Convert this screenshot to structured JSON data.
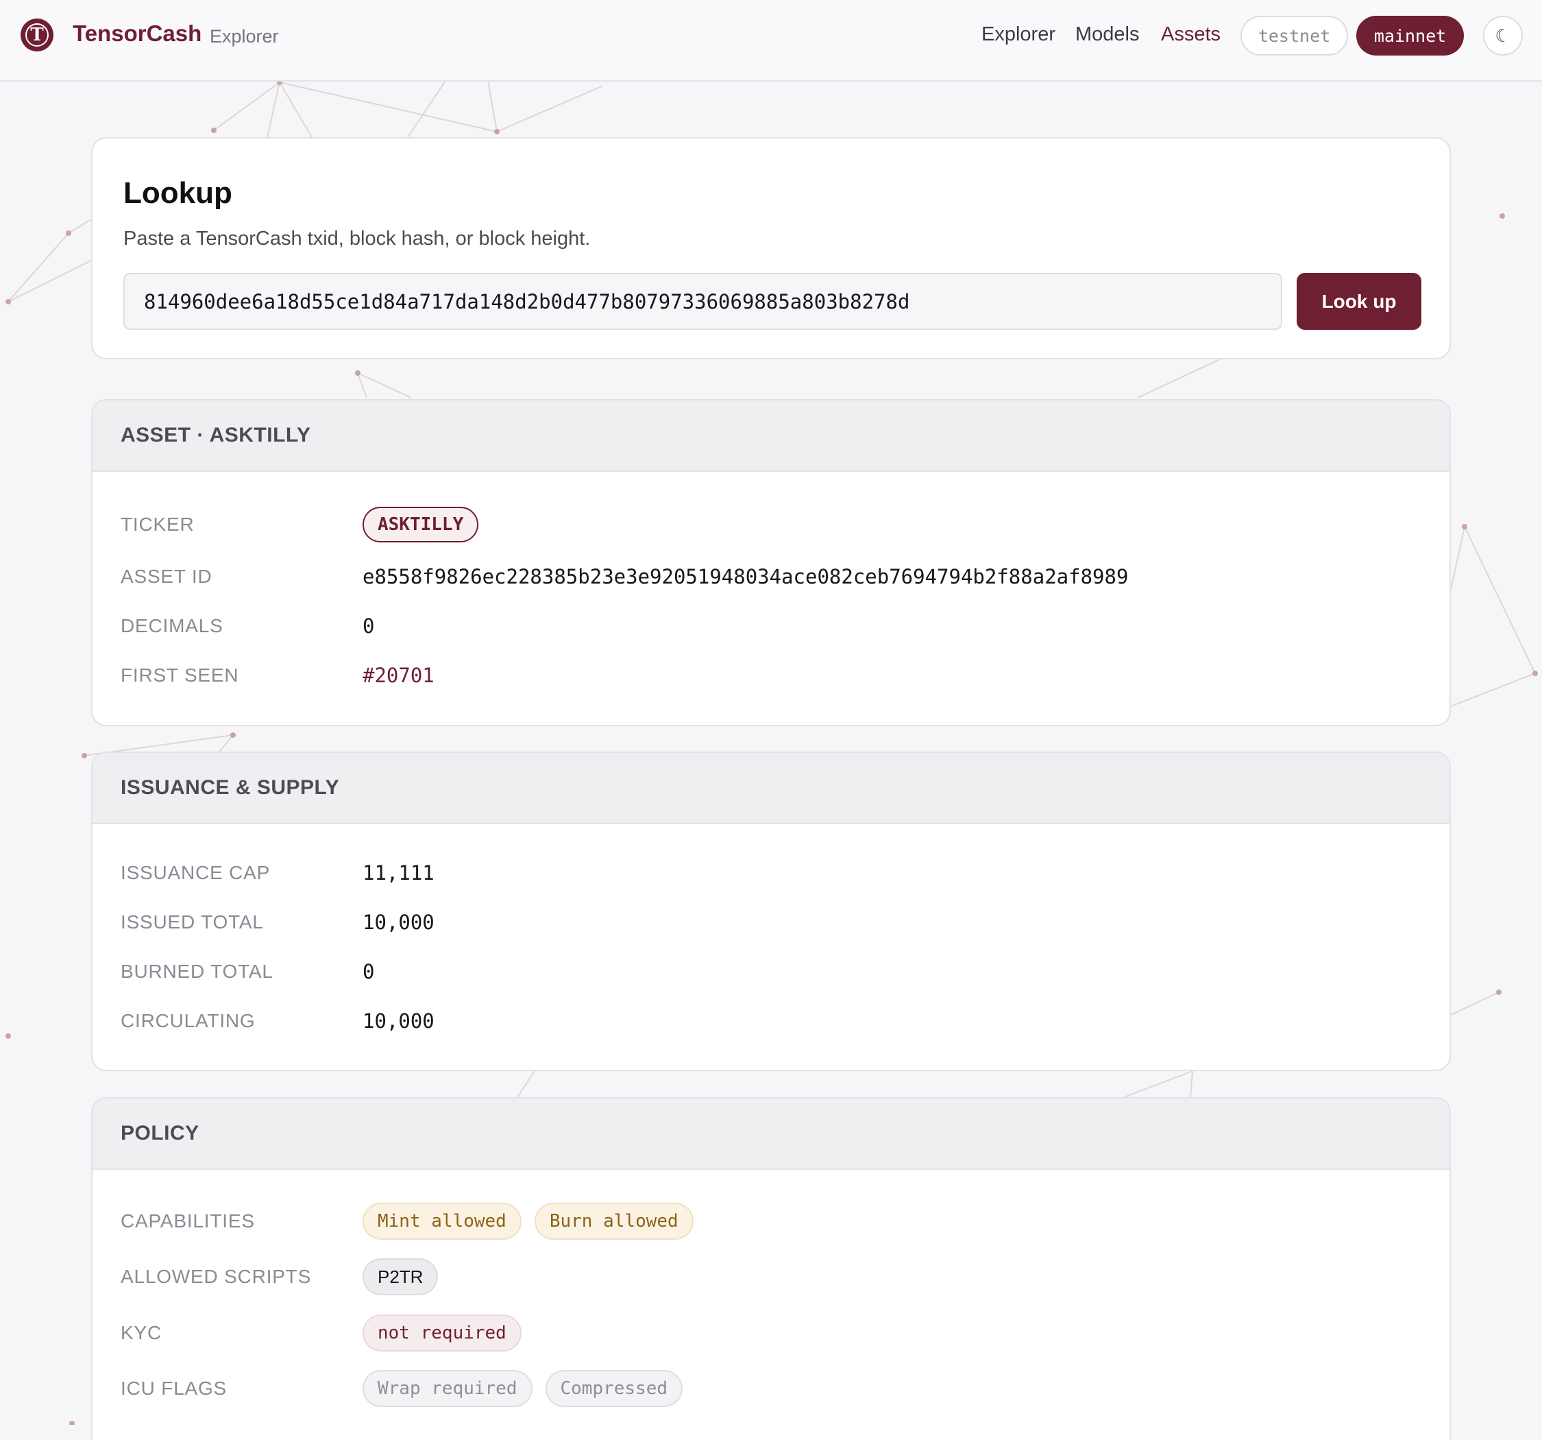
{
  "header": {
    "brand": "TensorCash",
    "brand_sub": "Explorer",
    "logo_letter": "T",
    "nav": {
      "explorer": "Explorer",
      "models": "Models",
      "assets": "Assets"
    },
    "network": {
      "testnet": "testnet",
      "mainnet": "mainnet",
      "active": "mainnet"
    },
    "theme_toggle": "☾"
  },
  "lookup": {
    "title": "Lookup",
    "description": "Paste a TensorCash txid, block hash, or block height.",
    "input_value": "814960dee6a18d55ce1d84a717da148d2b0d477b80797336069885a803b8278d",
    "button": "Look up"
  },
  "asset": {
    "heading": "ASSET · ASKTILLY",
    "ticker_label": "TICKER",
    "ticker": "ASKTILLY",
    "asset_id_label": "ASSET ID",
    "asset_id": "e8558f9826ec228385b23e3e92051948034ace082ceb7694794b2f88a2af8989",
    "decimals_label": "DECIMALS",
    "decimals": "0",
    "first_seen_label": "FIRST SEEN",
    "first_seen": "#20701"
  },
  "supply": {
    "heading": "ISSUANCE & SUPPLY",
    "cap_label": "ISSUANCE CAP",
    "cap": "11,111",
    "issued_label": "ISSUED TOTAL",
    "issued": "10,000",
    "burned_label": "BURNED TOTAL",
    "burned": "0",
    "circulating_label": "CIRCULATING",
    "circulating": "10,000"
  },
  "policy": {
    "heading": "POLICY",
    "capabilities_label": "CAPABILITIES",
    "capabilities": [
      "Mint allowed",
      "Burn allowed"
    ],
    "scripts_label": "ALLOWED SCRIPTS",
    "scripts": [
      "P2TR"
    ],
    "kyc_label": "KYC",
    "kyc": "not required",
    "icu_label": "ICU FLAGS",
    "icu_flags": [
      "Wrap required",
      "Compressed"
    ]
  },
  "colors": {
    "brand": "#6e1f31",
    "background": "#f6f6f8",
    "warn": "#8a6416"
  }
}
